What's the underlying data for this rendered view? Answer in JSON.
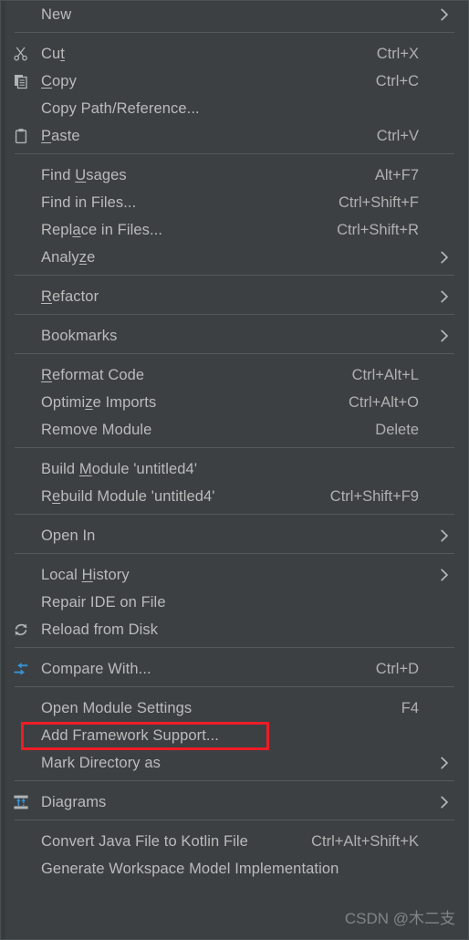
{
  "menu": {
    "name": "idea-project-context-menu",
    "background_color": "#3c4043",
    "text_color": "#bbbbbb",
    "separator_color": "#55595c",
    "highlight_color": "#ee1c25",
    "groups": [
      {
        "items": [
          {
            "label": "New",
            "mnemonic": "",
            "shortcut": "",
            "submenu": true,
            "icon": ""
          }
        ]
      },
      {
        "items": [
          {
            "label": "Cut",
            "mnemonic": "t",
            "shortcut": "Ctrl+X",
            "submenu": false,
            "icon": "scissors-icon"
          },
          {
            "label": "Copy",
            "mnemonic": "C",
            "shortcut": "Ctrl+C",
            "submenu": false,
            "icon": "copy-icon"
          },
          {
            "label": "Copy Path/Reference...",
            "mnemonic": "",
            "shortcut": "",
            "submenu": false,
            "icon": ""
          },
          {
            "label": "Paste",
            "mnemonic": "P",
            "shortcut": "Ctrl+V",
            "submenu": false,
            "icon": "clipboard-icon"
          }
        ]
      },
      {
        "items": [
          {
            "label": "Find Usages",
            "mnemonic": "U",
            "shortcut": "Alt+F7",
            "submenu": false,
            "icon": ""
          },
          {
            "label": "Find in Files...",
            "mnemonic": "",
            "shortcut": "Ctrl+Shift+F",
            "submenu": false,
            "icon": ""
          },
          {
            "label": "Replace in Files...",
            "mnemonic": "a",
            "shortcut": "Ctrl+Shift+R",
            "submenu": false,
            "icon": ""
          },
          {
            "label": "Analyze",
            "mnemonic": "z",
            "shortcut": "",
            "submenu": true,
            "icon": ""
          }
        ]
      },
      {
        "items": [
          {
            "label": "Refactor",
            "mnemonic": "R",
            "shortcut": "",
            "submenu": true,
            "icon": ""
          }
        ]
      },
      {
        "items": [
          {
            "label": "Bookmarks",
            "mnemonic": "",
            "shortcut": "",
            "submenu": true,
            "icon": ""
          }
        ]
      },
      {
        "items": [
          {
            "label": "Reformat Code",
            "mnemonic": "R",
            "shortcut": "Ctrl+Alt+L",
            "submenu": false,
            "icon": ""
          },
          {
            "label": "Optimize Imports",
            "mnemonic": "z",
            "shortcut": "Ctrl+Alt+O",
            "submenu": false,
            "icon": ""
          },
          {
            "label": "Remove Module",
            "mnemonic": "",
            "shortcut": "Delete",
            "submenu": false,
            "icon": ""
          }
        ]
      },
      {
        "items": [
          {
            "label": "Build Module 'untitled4'",
            "mnemonic": "M",
            "shortcut": "",
            "submenu": false,
            "icon": ""
          },
          {
            "label": "Rebuild Module 'untitled4'",
            "mnemonic": "e",
            "shortcut": "Ctrl+Shift+F9",
            "submenu": false,
            "icon": ""
          }
        ]
      },
      {
        "items": [
          {
            "label": "Open In",
            "mnemonic": "",
            "shortcut": "",
            "submenu": true,
            "icon": ""
          }
        ]
      },
      {
        "items": [
          {
            "label": "Local History",
            "mnemonic": "H",
            "shortcut": "",
            "submenu": true,
            "icon": ""
          },
          {
            "label": "Repair IDE on File",
            "mnemonic": "",
            "shortcut": "",
            "submenu": false,
            "icon": ""
          },
          {
            "label": "Reload from Disk",
            "mnemonic": "",
            "shortcut": "",
            "submenu": false,
            "icon": "reload-icon"
          }
        ]
      },
      {
        "items": [
          {
            "label": "Compare With...",
            "mnemonic": "",
            "shortcut": "Ctrl+D",
            "submenu": false,
            "icon": "compare-icon"
          }
        ]
      },
      {
        "items": [
          {
            "label": "Open Module Settings",
            "mnemonic": "",
            "shortcut": "F4",
            "submenu": false,
            "icon": ""
          },
          {
            "label": "Add Framework Support...",
            "mnemonic": "",
            "shortcut": "",
            "submenu": false,
            "icon": "",
            "highlighted": true
          },
          {
            "label": "Mark Directory as",
            "mnemonic": "",
            "shortcut": "",
            "submenu": true,
            "icon": ""
          }
        ]
      },
      {
        "items": [
          {
            "label": "Diagrams",
            "mnemonic": "",
            "shortcut": "",
            "submenu": true,
            "icon": "diagrams-icon"
          }
        ]
      },
      {
        "items": [
          {
            "label": "Convert Java File to Kotlin File",
            "mnemonic": "",
            "shortcut": "Ctrl+Alt+Shift+K",
            "submenu": false,
            "icon": ""
          },
          {
            "label": "Generate Workspace Model Implementation",
            "mnemonic": "",
            "shortcut": "",
            "submenu": false,
            "icon": ""
          }
        ]
      }
    ]
  },
  "watermark": {
    "text": "CSDN @木二支"
  }
}
